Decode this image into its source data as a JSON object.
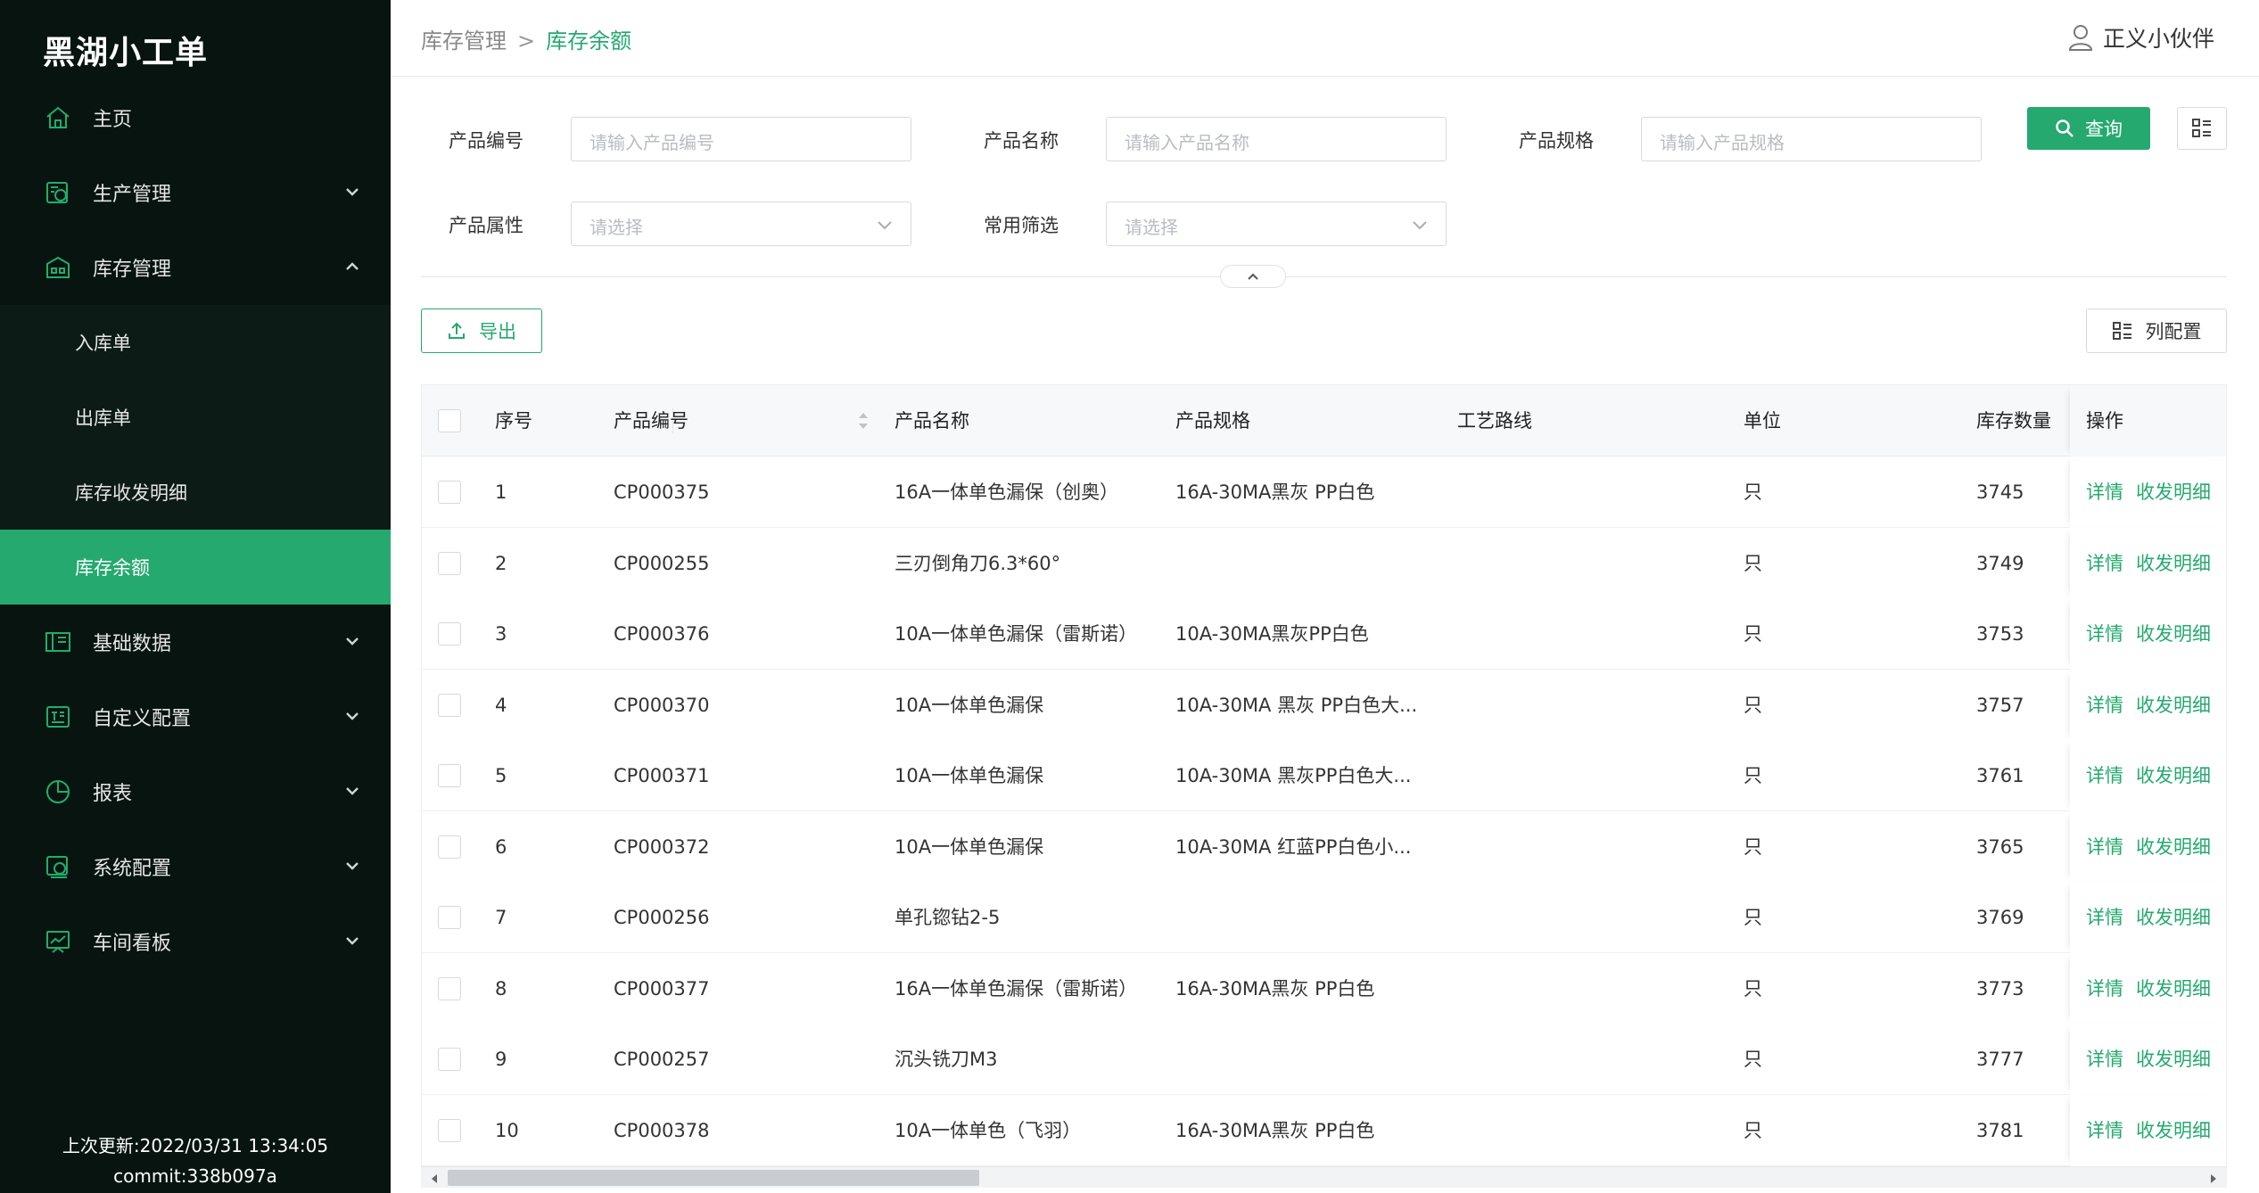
{
  "app": {
    "title": "黑湖小工单"
  },
  "sidebar": {
    "items": [
      {
        "label": "主页",
        "icon": "home-icon"
      },
      {
        "label": "生产管理",
        "icon": "production-icon",
        "expandable": true
      },
      {
        "label": "库存管理",
        "icon": "warehouse-icon",
        "expandable": true,
        "expanded": true,
        "children": [
          {
            "label": "入库单"
          },
          {
            "label": "出库单"
          },
          {
            "label": "库存收发明细"
          },
          {
            "label": "库存余额",
            "active": true
          }
        ]
      },
      {
        "label": "基础数据",
        "icon": "book-icon",
        "expandable": true
      },
      {
        "label": "自定义配置",
        "icon": "custom-config-icon",
        "expandable": true
      },
      {
        "label": "报表",
        "icon": "pie-chart-icon",
        "expandable": true
      },
      {
        "label": "系统配置",
        "icon": "system-settings-icon",
        "expandable": true
      },
      {
        "label": "车间看板",
        "icon": "monitor-icon",
        "expandable": true
      }
    ],
    "footer": {
      "updated": "上次更新:2022/03/31 13:34:05",
      "commit": "commit:338b097a"
    }
  },
  "header": {
    "breadcrumb": [
      "库存管理",
      "库存余额"
    ],
    "breadcrumb_sep": ">",
    "user": "正义小伙伴"
  },
  "filters": {
    "code_label": "产品编号",
    "code_placeholder": "请输入产品编号",
    "name_label": "产品名称",
    "name_placeholder": "请输入产品名称",
    "spec_label": "产品规格",
    "spec_placeholder": "请输入产品规格",
    "attr_label": "产品属性",
    "attr_placeholder": "请选择",
    "common_label": "常用筛选",
    "common_placeholder": "请选择",
    "query_label": "查询"
  },
  "toolbar": {
    "export_label": "导出",
    "column_config_label": "列配置"
  },
  "table": {
    "columns": [
      "序号",
      "产品编号",
      "产品名称",
      "产品规格",
      "工艺路线",
      "单位",
      "库存数量",
      "操作"
    ],
    "action_detail": "详情",
    "action_flow": "收发明细",
    "rows": [
      {
        "no": "1",
        "code": "CP000375",
        "name": "16A一体单色漏保（创奥）",
        "spec": "16A-30MA黑灰 PP白色",
        "route": "",
        "unit": "只",
        "qty": "3745"
      },
      {
        "no": "2",
        "code": "CP000255",
        "name": "三刃倒角刀6.3*60°",
        "spec": "",
        "route": "",
        "unit": "只",
        "qty": "3749"
      },
      {
        "no": "3",
        "code": "CP000376",
        "name": "10A一体单色漏保（雷斯诺）",
        "spec": "10A-30MA黑灰PP白色",
        "route": "",
        "unit": "只",
        "qty": "3753"
      },
      {
        "no": "4",
        "code": "CP000370",
        "name": "10A一体单色漏保",
        "spec": "10A-30MA 黑灰 PP白色大...",
        "route": "",
        "unit": "只",
        "qty": "3757"
      },
      {
        "no": "5",
        "code": "CP000371",
        "name": "10A一体单色漏保",
        "spec": "10A-30MA 黑灰PP白色大...",
        "route": "",
        "unit": "只",
        "qty": "3761"
      },
      {
        "no": "6",
        "code": "CP000372",
        "name": "10A一体单色漏保",
        "spec": "10A-30MA 红蓝PP白色小...",
        "route": "",
        "unit": "只",
        "qty": "3765"
      },
      {
        "no": "7",
        "code": "CP000256",
        "name": "单孔锪钻2-5",
        "spec": "",
        "route": "",
        "unit": "只",
        "qty": "3769"
      },
      {
        "no": "8",
        "code": "CP000377",
        "name": "16A一体单色漏保（雷斯诺）",
        "spec": "16A-30MA黑灰 PP白色",
        "route": "",
        "unit": "只",
        "qty": "3773"
      },
      {
        "no": "9",
        "code": "CP000257",
        "name": "沉头铣刀M3",
        "spec": "",
        "route": "",
        "unit": "只",
        "qty": "3777"
      },
      {
        "no": "10",
        "code": "CP000378",
        "name": "10A一体单色（飞羽）",
        "spec": "16A-30MA黑灰 PP白色",
        "route": "",
        "unit": "只",
        "qty": "3781"
      }
    ]
  },
  "colors": {
    "accent": "#25a96f",
    "sidebar_bg": "#071410"
  }
}
